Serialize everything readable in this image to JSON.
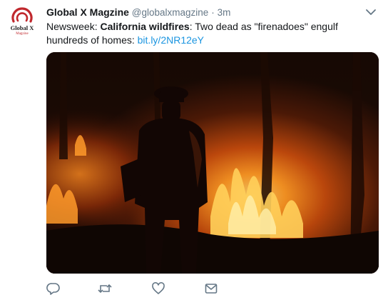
{
  "tweet": {
    "avatar": {
      "brand_line": "Global X",
      "brand_sub": "Magzine"
    },
    "author": {
      "display_name": "Global X Magzine",
      "handle": "@globalxmagzine",
      "separator": "·",
      "timestamp": "3m"
    },
    "text": {
      "source": "Newsweek: ",
      "topic": "California wildfires",
      "rest": ": Two dead as \"firenadoes\" engulf hundreds of homes: ",
      "link": "bit.ly/2NR12eY"
    },
    "actions": [
      {
        "name": "reply",
        "icon": "reply-icon"
      },
      {
        "name": "retweet",
        "icon": "retweet-icon"
      },
      {
        "name": "like",
        "icon": "heart-icon"
      },
      {
        "name": "message",
        "icon": "envelope-icon"
      }
    ],
    "colors": {
      "link": "#1b95e0",
      "muted": "#657786",
      "icon": "#657786",
      "brand_red": "#c0282d"
    }
  }
}
